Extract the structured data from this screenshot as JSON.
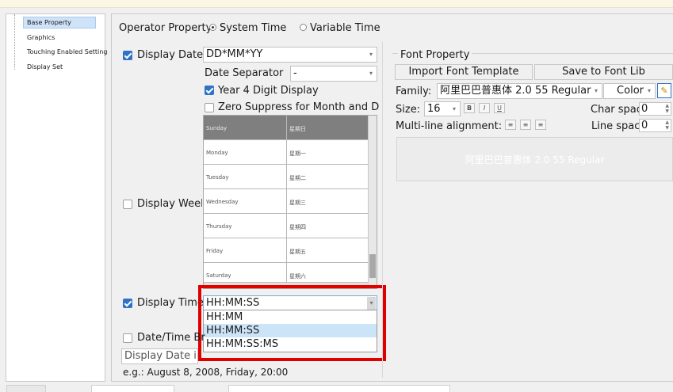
{
  "sidebar": {
    "items": [
      {
        "label": "Base Property",
        "selected": true
      },
      {
        "label": "Graphics"
      },
      {
        "label": "Touching Enabled Setting"
      },
      {
        "label": "Display Set"
      }
    ]
  },
  "operator": {
    "label": "Operator Property:",
    "options": [
      "System Time",
      "Variable Time"
    ],
    "selected": "System Time"
  },
  "display_date": {
    "label": "Display Date",
    "checked": true,
    "format_value": "DD*MM*YY",
    "separator_label": "Date Separator",
    "separator_value": "-",
    "year4_label": "Year 4 Digit Display",
    "year4_checked": true,
    "zero_label": "Zero Suppress for Month and Day",
    "zero_checked": false
  },
  "display_week": {
    "label": "Display Week",
    "checked": false,
    "rows": [
      {
        "en": "Sunday",
        "zh": "星期日"
      },
      {
        "en": "Monday",
        "zh": "星期一"
      },
      {
        "en": "Tuesday",
        "zh": "星期二"
      },
      {
        "en": "Wednesday",
        "zh": "星期三"
      },
      {
        "en": "Thursday",
        "zh": "星期四"
      },
      {
        "en": "Friday",
        "zh": "星期五"
      },
      {
        "en": "Saturday",
        "zh": "星期六"
      }
    ]
  },
  "display_time": {
    "label": "Display Time",
    "checked": true,
    "value": "HH:MM:SS",
    "options": [
      "HH:MM",
      "HH:MM:SS",
      "HH:MM:SS:MS"
    ],
    "selected": "HH:MM:SS"
  },
  "datetime_break": {
    "label": "Date/Time Br",
    "checked": false,
    "combo_value": "Display Date in the First Line",
    "example": "e.g.: August 8, 2008, Friday, 20:00"
  },
  "font_property": {
    "title": "Font Property",
    "import_label": "Import Font Template",
    "save_label": "Save to Font Lib",
    "family_label": "Family:",
    "family_value": "阿里巴巴普惠体 2.0 55 Regular",
    "color_label": "Color",
    "size_label": "Size:",
    "size_value": "16",
    "bold": "B",
    "italic": "I",
    "underline": "U",
    "char_spacing_label": "Char spac",
    "char_spacing_value": "0",
    "multiline_label": "Multi-line alignment:",
    "line_spacing_label": "Line spac",
    "line_spacing_value": "0",
    "preview_text": "阿里巴巴普惠体 2.0 55 Regular"
  },
  "colors": {
    "accent": "#2f73c7",
    "highlight": "#e10000",
    "selection": "#cce4f7"
  }
}
